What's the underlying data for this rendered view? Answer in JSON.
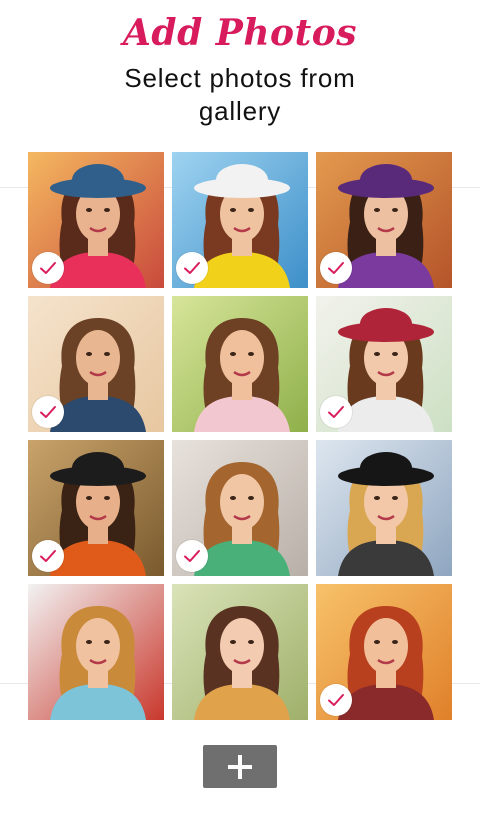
{
  "header": {
    "title": "Add Photos",
    "subtitle": "Select photos from gallery"
  },
  "theme": {
    "title_color": "#d81b5c",
    "check_color": "#d81b5c",
    "add_button_color": "#6f6f6f"
  },
  "gallery": {
    "photos": [
      {
        "selected": true,
        "bg": "#c94a3c",
        "bg2": "#f4b860",
        "hair": "#5a2a1a",
        "skin": "#e9b38f",
        "top": "#e8305a",
        "hat": "#2f5f8a"
      },
      {
        "selected": true,
        "bg": "#3d8fc9",
        "bg2": "#9ed3f0",
        "hair": "#7a3a22",
        "skin": "#f0c3a0",
        "top": "#f2d11a",
        "hat": "#f2f2f2"
      },
      {
        "selected": true,
        "bg": "#b5542a",
        "bg2": "#e39a4e",
        "hair": "#3b2115",
        "skin": "#eec0a2",
        "top": "#7b3a9e",
        "hat": "#5a2a7a"
      },
      {
        "selected": true,
        "bg": "#e7c7a0",
        "bg2": "#f5e3cc",
        "hair": "#6b4226",
        "skin": "#e8b690",
        "top": "#2b4a6e",
        "hat": "none"
      },
      {
        "selected": false,
        "bg": "#8fb04a",
        "bg2": "#d7e59a",
        "hair": "#6e4024",
        "skin": "#f0c09c",
        "top": "#f3c7cf",
        "hat": "none"
      },
      {
        "selected": true,
        "bg": "#cde0c4",
        "bg2": "#f2f2ec",
        "hair": "#6a3a1e",
        "skin": "#f3c9ab",
        "top": "#ececec",
        "hat": "#b0243a"
      },
      {
        "selected": true,
        "bg": "#7a5a2e",
        "bg2": "#c9a36a",
        "hair": "#3a2214",
        "skin": "#e7b08a",
        "top": "#e05a1a",
        "hat": "#1c1c1c"
      },
      {
        "selected": true,
        "bg": "#b8b0a8",
        "bg2": "#e8e2dc",
        "hair": "#a5652e",
        "skin": "#f1c6a4",
        "top": "#49b07a",
        "hat": "none"
      },
      {
        "selected": false,
        "bg": "#8fa6c0",
        "bg2": "#dde6ef",
        "hair": "#d9a652",
        "skin": "#f2c8a8",
        "top": "#3a3a3a",
        "hat": "#161616"
      },
      {
        "selected": false,
        "bg": "#c9382c",
        "bg2": "#f2f2f2",
        "hair": "#c98a3a",
        "skin": "#f0c2a0",
        "top": "#7ec4d8",
        "hat": "none"
      },
      {
        "selected": false,
        "bg": "#9fb06a",
        "bg2": "#d9e3b8",
        "hair": "#5a3222",
        "skin": "#f3cbb0",
        "top": "#e0a24a",
        "hat": "none"
      },
      {
        "selected": true,
        "bg": "#e0802a",
        "bg2": "#f7c26a",
        "hair": "#b8401e",
        "skin": "#f1bf9a",
        "top": "#8a2a2a",
        "hat": "none"
      }
    ]
  },
  "actions": {
    "add_icon": "plus-icon"
  }
}
